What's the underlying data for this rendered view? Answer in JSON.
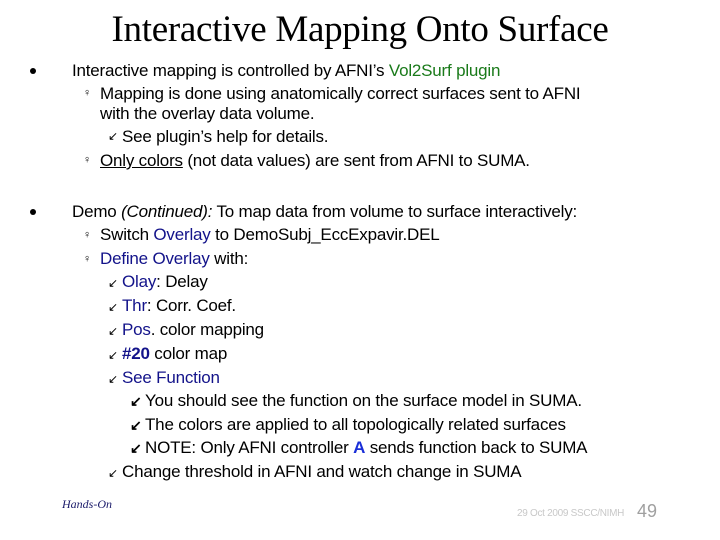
{
  "slide": {
    "title": "Interactive Mapping Onto Surface",
    "section1": {
      "text_a": "Interactive mapping is controlled by AFNI’s ",
      "text_link": "Vol2Surf plugin",
      "sub1_line1": "Mapping is done using anatomically correct surfaces sent to AFNI",
      "sub1_line2": "with the overlay data volume.",
      "sub1_child": "See plugin’s help for details.",
      "sub2_underlined": "Only colors",
      "sub2_rest": " (not data values) are sent from AFNI to SUMA."
    },
    "section2": {
      "text_a": "Demo ",
      "text_italic": "(Continued):",
      "text_b": " To map data from volume to surface interactively:",
      "sub1_a": "Switch ",
      "sub1_blue": "Overlay",
      "sub1_b": " to DemoSubj_EccExpavir.DEL",
      "sub2_blue": "Define Overlay",
      "sub2_b": " with:",
      "items": [
        {
          "blue": "Olay",
          "rest": ": Delay"
        },
        {
          "blue": "Thr",
          "rest": ": Corr. Coef."
        },
        {
          "blue": "Pos",
          "rest": ". color mapping"
        },
        {
          "blue": "#20",
          "rest": " color map"
        },
        {
          "blue": "See Function",
          "rest": ""
        }
      ],
      "see_function_children": [
        {
          "text": "You should see the function on the surface model in SUMA."
        },
        {
          "text": "The colors are applied to all topologically related surfaces"
        },
        {
          "text_a": "NOTE: Only AFNI controller ",
          "highlight": "A",
          "text_b": " sends function back to SUMA"
        }
      ],
      "last_item": "Change threshold in AFNI and watch change  in SUMA"
    },
    "footer": {
      "left": "Hands-On",
      "right": "29 Oct 2009 SSCC/NIMH",
      "page_number": "49"
    },
    "icons": {
      "level1": "round-bullet-icon",
      "level2": "pushpin-bullet-icon",
      "level3": "arrow-down-left-icon",
      "level4": "bold-arrow-down-left-icon"
    },
    "colors": {
      "link_green": "#1a7a1a",
      "keyword_blue": "#13138a",
      "controller_blue": "#1a2fd8"
    }
  }
}
